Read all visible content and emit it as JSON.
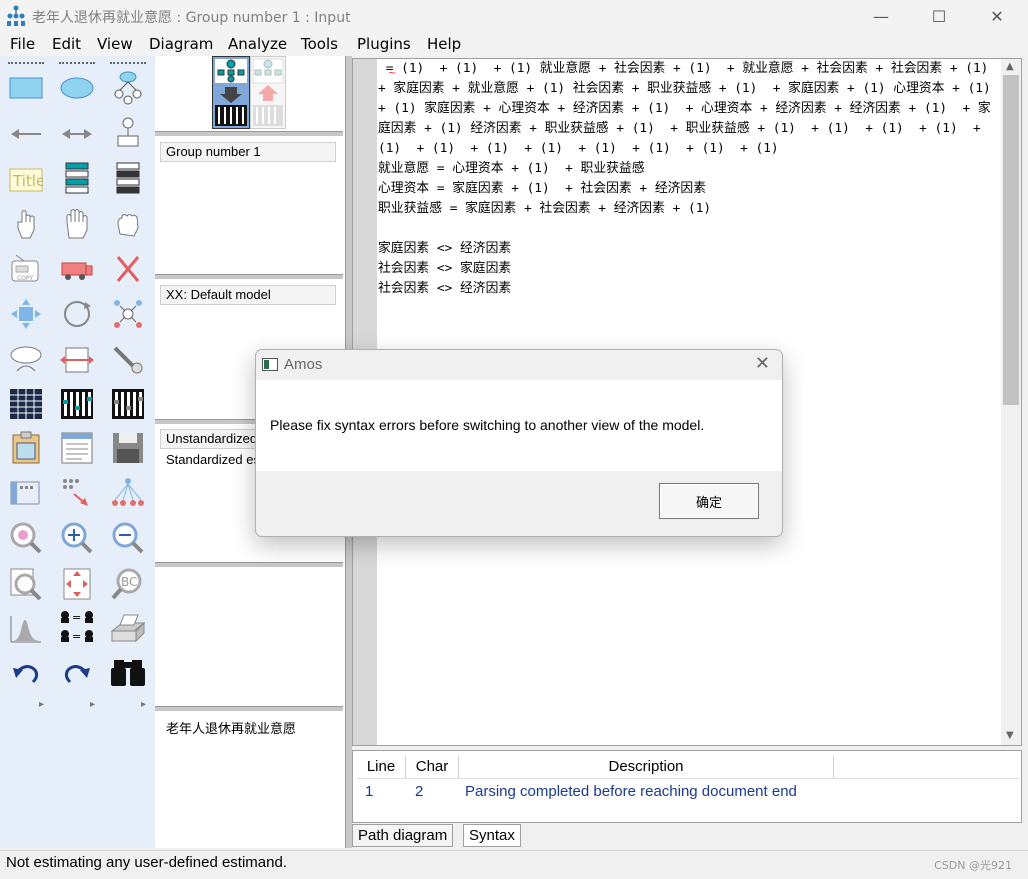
{
  "window": {
    "title": "老年人退休再就业意愿 : Group number 1 : Input",
    "minimize": "—",
    "maximize": "☐",
    "close": "✕"
  },
  "menu": [
    "File",
    "Edit",
    "View",
    "Diagram",
    "Analyze",
    "Tools",
    "Plugins",
    "Help"
  ],
  "toolbox": {
    "title_tool_label": "Title",
    "equal_label": "=",
    "expand_marks": [
      "▸",
      "▸",
      "▸"
    ]
  },
  "panel": {
    "group": "Group number 1",
    "model": "XX: Default model",
    "estimates_1": "Unstandardized estimates",
    "estimates_2": "Standardized estimates",
    "file_name": "老年人退休再就业意愿"
  },
  "editor": {
    "lines": [
      " = (1)  + (1)  + (1) 就业意愿 + 社会因素 + (1)  + 就业意愿 + 社会因素 + 社会因素 + (1)  + 家庭因素 + 就业意愿 + (1) 社会因素 + 职业获益感 + (1)  + 家庭因素 + (1) 心理资本 + (1)  + (1) 家庭因素 + 心理资本 + 经济因素 + (1)  + 心理资本 + 经济因素 + 经济因素 + (1)  + 家庭因素 + (1) 经济因素 + 职业获益感 + (1)  + 职业获益感 + (1)  + (1)  + (1)  + (1)  + (1)  + (1)  + (1)  + (1)  + (1)  + (1)  + (1)  + (1)",
      "就业意愿 = 心理资本 + (1)  + 职业获益感",
      "心理资本 = 家庭因素 + (1)  + 社会因素 + 经济因素",
      "职业获益感 = 家庭因素 + 社会因素 + 经济因素 + (1)",
      "",
      "家庭因素 <> 经济因素",
      "社会因素 <> 家庭因素",
      "社会因素 <> 经济因素"
    ]
  },
  "errors": {
    "headers": [
      "Line",
      "Char",
      "Description"
    ],
    "rows": [
      {
        "line": "1",
        "char": "2",
        "description": "Parsing completed before reaching document end"
      }
    ]
  },
  "tabs": [
    "Path diagram",
    "Syntax"
  ],
  "status": "Not estimating any user-defined estimand.",
  "watermark": "CSDN @光921",
  "dialog": {
    "title": "Amos",
    "message": "Please fix syntax errors before switching to another view of the model.",
    "ok": "确定",
    "close": "✕"
  },
  "colors": {
    "toolbox_bg": "#e6eef9",
    "accent_teal": "#00a0a8",
    "icon_blue": "#2a5db0",
    "error_text": "#1a3a90"
  }
}
